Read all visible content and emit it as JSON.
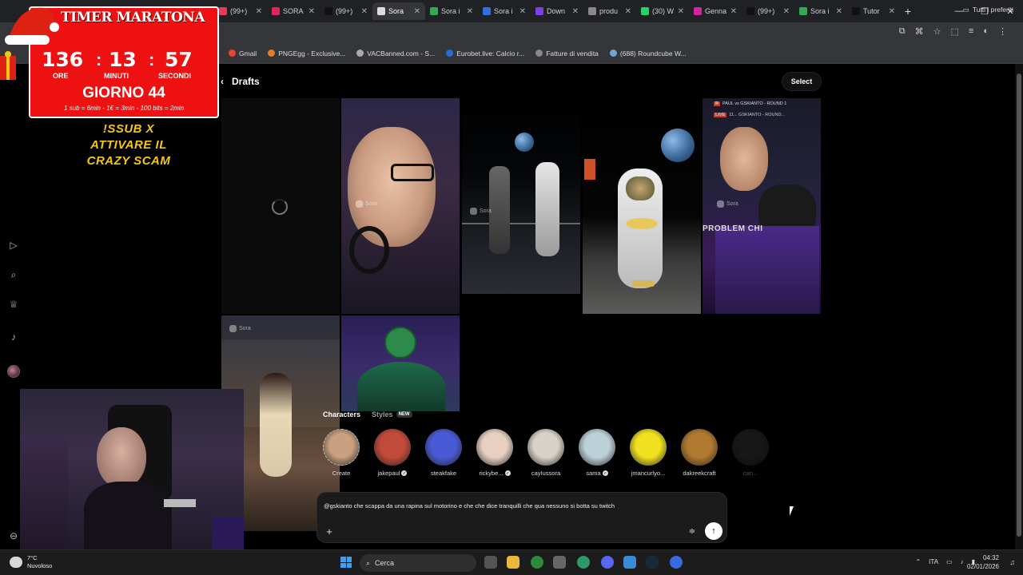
{
  "tabs": [
    {
      "label": "(99+)",
      "color": "#e33b5e",
      "active": false
    },
    {
      "label": "SORA",
      "color": "#e0245e",
      "active": false
    },
    {
      "label": "(99+)",
      "color": "#111111",
      "active": false
    },
    {
      "label": "Sora",
      "color": "#dddddd",
      "active": true
    },
    {
      "label": "Sora i",
      "color": "#35a854",
      "active": false
    },
    {
      "label": "Sora i",
      "color": "#2f6fe0",
      "active": false
    },
    {
      "label": "Down",
      "color": "#7b3fe4",
      "active": false
    },
    {
      "label": "produ",
      "color": "#888888",
      "active": false
    },
    {
      "label": "(30) W",
      "color": "#25d366",
      "active": false
    },
    {
      "label": "Genna",
      "color": "#d6249f",
      "active": false
    },
    {
      "label": "(99+)",
      "color": "#111111",
      "active": false
    },
    {
      "label": "Sora i",
      "color": "#35a854",
      "active": false
    },
    {
      "label": "Tutor",
      "color": "#111111",
      "active": false
    }
  ],
  "bookmarks": [
    {
      "label": "Gmail",
      "color": "#ea4335"
    },
    {
      "label": "PNGEgg - Exclusive...",
      "color": "#e57b2c"
    },
    {
      "label": "VACBanned.com - S...",
      "color": "#aaaaaa"
    },
    {
      "label": "Eurobet.live: Calcio r...",
      "color": "#2a6cd6"
    },
    {
      "label": "Fatture di vendita",
      "color": "#888888"
    },
    {
      "label": "(688) Roundcube W...",
      "color": "#6aa9d6"
    }
  ],
  "bookmarks_right": "Tutti i preferiti",
  "page": {
    "title": "Drafts",
    "select_label": "Select"
  },
  "tiles": {
    "watermark": "Sora",
    "badge_main": "PAUL vs GSKIANTO - ROUND 1",
    "badge_live": "LIVE",
    "badge_sub": "11... GSKIANTO - ROUND...",
    "problem_text": "PROBLEM CHI"
  },
  "characters": {
    "tab_characters": "Characters",
    "tab_styles": "Styles",
    "new_badge": "NEW",
    "items": [
      {
        "name": "Create",
        "verified": false,
        "color": "#c9a080"
      },
      {
        "name": "jakepaul",
        "verified": true,
        "color": "#c24a3a"
      },
      {
        "name": "steakfake",
        "verified": false,
        "color": "#4a5ad6"
      },
      {
        "name": "rickybe...",
        "verified": true,
        "color": "#e8d0c0"
      },
      {
        "name": "cayIussora",
        "verified": false,
        "color": "#d9d2c8"
      },
      {
        "name": "sama",
        "verified": true,
        "color": "#bcd0d8"
      },
      {
        "name": "jmancurlyo...",
        "verified": false,
        "color": "#f0e020"
      },
      {
        "name": "dakreekcraft",
        "verified": false,
        "color": "#b07a30"
      },
      {
        "name": "can...",
        "verified": false,
        "color": "#444444"
      }
    ]
  },
  "composer": {
    "prompt": "@gskianto  che scappa da una rapina sul motorino e che che dice tranquilli che qua nessuno si botta su twitch"
  },
  "overlay": {
    "title": "TIMER MARATONA",
    "hours": "136",
    "minutes": "13",
    "seconds": "57",
    "hours_label": "ORE",
    "minutes_label": "MINUTI",
    "seconds_label": "SECONDI",
    "day": "GIORNO 44",
    "rates": "1 sub = 6min - 1€ = 3min - 100 bits = 2min",
    "scam_line1": "!SSUB X",
    "scam_line2": "ATTIVARE IL",
    "scam_line3": "CRAZY SCAM"
  },
  "taskbar": {
    "temp": "7°C",
    "weather": "Nuvoloso",
    "search": "Cerca",
    "lang": "ITA",
    "time": "04:32",
    "date": "02/01/2026"
  }
}
